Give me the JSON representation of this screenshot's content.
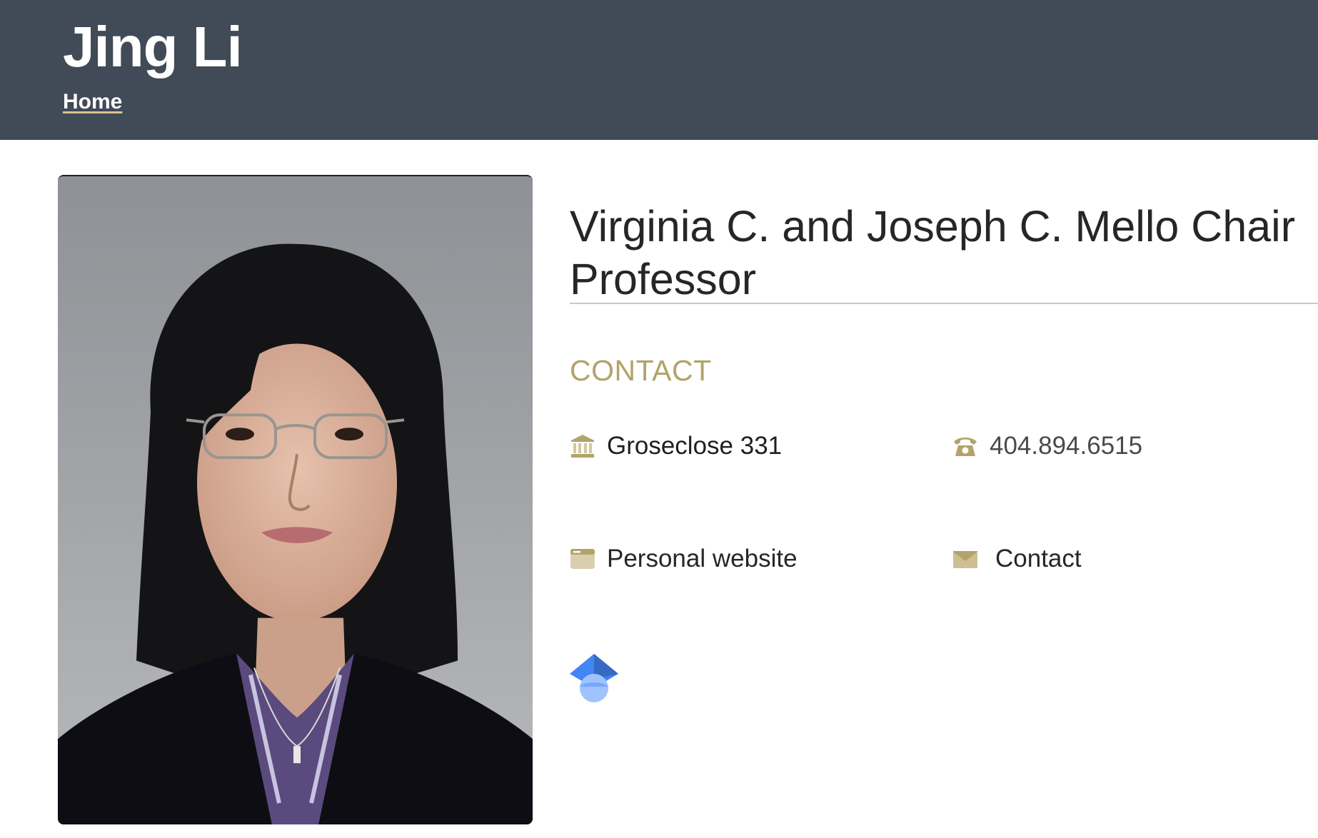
{
  "header": {
    "name": "Jing Li",
    "breadcrumb": {
      "home_label": "Home"
    }
  },
  "profile": {
    "portrait_alt": "Jing Li",
    "job_title": "Virginia C. and Joseph C. Mello Chair Professor"
  },
  "contact": {
    "heading": "CONTACT",
    "address": {
      "icon": "building-icon",
      "text": "Groseclose 331"
    },
    "phone": {
      "icon": "phone-icon",
      "text": "404.894.6515"
    },
    "website": {
      "icon": "browser-window-icon",
      "text": "Personal website"
    },
    "email": {
      "icon": "envelope-icon",
      "text": "Contact"
    },
    "scholar": {
      "icon": "google-scholar-icon"
    }
  },
  "colors": {
    "header_bg": "#414a57",
    "accent_gold": "#b3a369",
    "scholar_blue": "#4285f4"
  }
}
